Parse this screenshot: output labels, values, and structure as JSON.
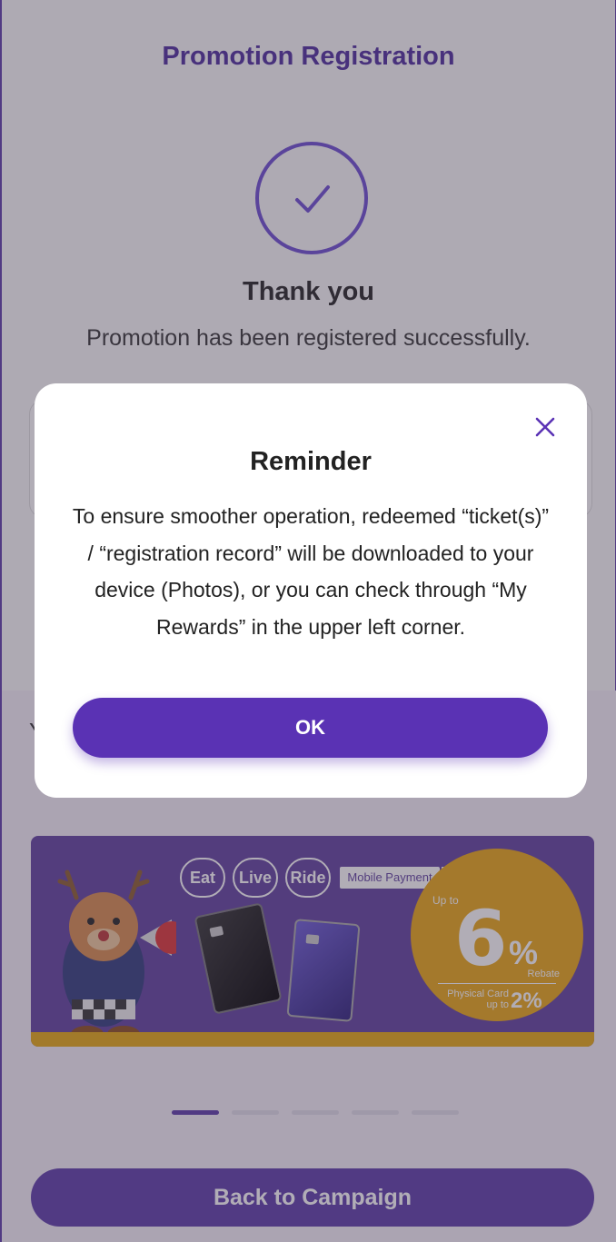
{
  "header": {
    "title": "Promotion Registration"
  },
  "result": {
    "heading": "Thank you",
    "message": "Promotion has been registered successfully."
  },
  "banner": {
    "pills": [
      "Eat",
      "Live",
      "Ride"
    ],
    "mobile_payment": "Mobile Payment",
    "up_to": "Up to",
    "big_number": "6",
    "percent": "%",
    "rebate": "Rebate",
    "physical_card": "Physical Card up to",
    "physical_value": "2%"
  },
  "carousel": {
    "total": 5,
    "active_index": 0
  },
  "footer": {
    "back_label": "Back to Campaign"
  },
  "modal": {
    "title": "Reminder",
    "body": "To ensure smoother operation, redeemed “ticket(s)” / “registration record” will be downloaded to your device (Photos), or you can check through “My Rewards” in the upper left corner.",
    "ok_label": "OK"
  },
  "colors": {
    "brand": "#5a3aa8",
    "accent": "#e8a512"
  }
}
